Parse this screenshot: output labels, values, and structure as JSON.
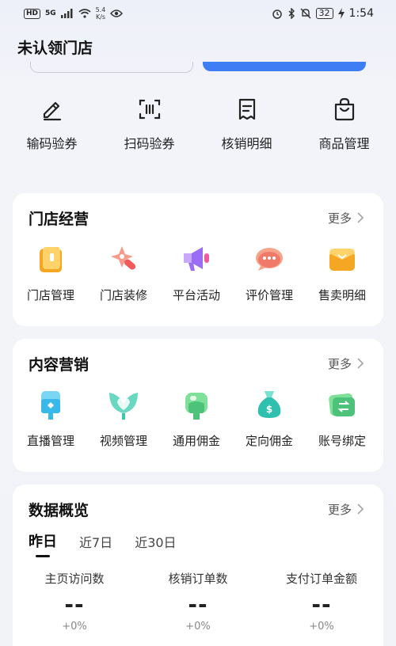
{
  "status_bar": {
    "network": "HD",
    "signal": "5G",
    "speed_value": "5.4",
    "speed_unit": "K/s",
    "battery": "32",
    "time": "1:54"
  },
  "header": {
    "title": "未认领门店"
  },
  "quick_tools": [
    {
      "label": "输码验券",
      "icon": "edit-code-icon"
    },
    {
      "label": "扫码验券",
      "icon": "scan-code-icon"
    },
    {
      "label": "核销明细",
      "icon": "receipt-icon"
    },
    {
      "label": "商品管理",
      "icon": "shopping-bag-icon"
    }
  ],
  "store_ops": {
    "title": "门店经营",
    "more": "更多",
    "items": [
      {
        "label": "门店管理",
        "icon": "store-icon",
        "color": "#f5a623"
      },
      {
        "label": "门店装修",
        "icon": "sparkle-icon",
        "color": "#f47c6a"
      },
      {
        "label": "平台活动",
        "icon": "megaphone-icon",
        "color": "#9b6cf5"
      },
      {
        "label": "评价管理",
        "icon": "chat-bubble-icon",
        "color": "#f58a6a"
      },
      {
        "label": "售卖明细",
        "icon": "sales-box-icon",
        "color": "#f5a623"
      }
    ]
  },
  "content_marketing": {
    "title": "内容营销",
    "more": "更多",
    "items": [
      {
        "label": "直播管理",
        "icon": "live-icon",
        "color": "#3ab8e8"
      },
      {
        "label": "视频管理",
        "icon": "video-heart-icon",
        "color": "#3cc8a8"
      },
      {
        "label": "通用佣金",
        "icon": "commission-icon",
        "color": "#4cc27a"
      },
      {
        "label": "定向佣金",
        "icon": "money-bag-icon",
        "color": "#2fc0b0"
      },
      {
        "label": "账号绑定",
        "icon": "account-bind-icon",
        "color": "#4cc27a"
      }
    ]
  },
  "data_overview": {
    "title": "数据概览",
    "more": "更多",
    "tabs": [
      "昨日",
      "近7日",
      "近30日"
    ],
    "stats": [
      {
        "label": "主页访问数",
        "value": "--",
        "delta": "+0%"
      },
      {
        "label": "核销订单数",
        "value": "--",
        "delta": "+0%"
      },
      {
        "label": "支付订单金额",
        "value": "--",
        "delta": "+0%"
      }
    ]
  }
}
